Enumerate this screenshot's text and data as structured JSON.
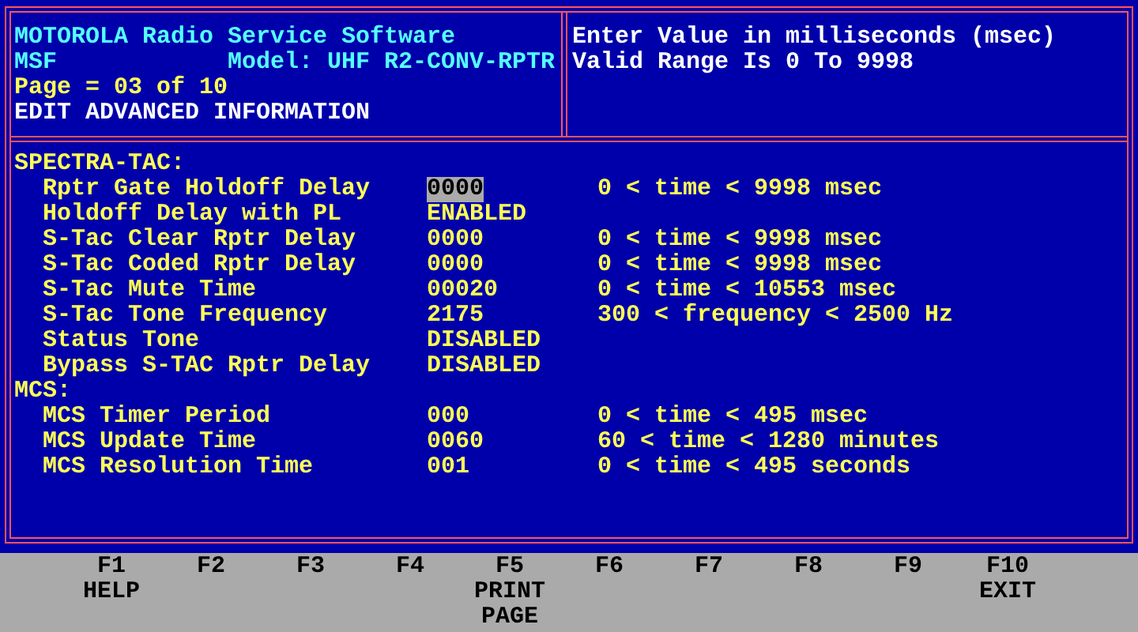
{
  "header": {
    "title": "MOTOROLA Radio Service Software",
    "app_code": "MSF",
    "model": "Model: UHF R2-CONV-RPTR",
    "page": "Page = 03 of 10",
    "mode": "EDIT ADVANCED INFORMATION"
  },
  "help": [
    "Enter Value in milliseconds (msec)",
    "Valid Range Is 0 To 9998"
  ],
  "sections": [
    {
      "heading": "SPECTRA-TAC:",
      "fields": [
        {
          "label": "Rptr Gate Holdoff Delay",
          "value": "0000",
          "range": "0 < time < 9998 msec",
          "selected": true
        },
        {
          "label": "Holdoff Delay with PL",
          "value": "ENABLED",
          "selected": false
        },
        {
          "label": "S-Tac Clear Rptr Delay",
          "value": "0000",
          "range": "0 < time < 9998 msec",
          "selected": false
        },
        {
          "label": "S-Tac Coded Rptr Delay",
          "value": "0000",
          "range": "0 < time < 9998 msec",
          "selected": false
        },
        {
          "label": "S-Tac Mute Time",
          "value": "00020",
          "range": "0 < time < 10553 msec",
          "selected": false
        },
        {
          "label": "S-Tac Tone Frequency",
          "value": "2175",
          "range": "300 < frequency < 2500 Hz",
          "selected": false
        },
        {
          "label": "Status Tone",
          "value": "DISABLED",
          "selected": false
        },
        {
          "label": "Bypass S-TAC Rptr Delay",
          "value": "DISABLED",
          "selected": false
        }
      ]
    },
    {
      "heading": "MCS:",
      "fields": [
        {
          "label": "MCS Timer Period",
          "value": "000",
          "range": "0 < time < 495 msec",
          "selected": false
        },
        {
          "label": "MCS Update Time",
          "value": "0060",
          "range": "60 < time < 1280 minutes",
          "selected": false
        },
        {
          "label": "MCS Resolution Time",
          "value": "001",
          "range": "0 < time < 495 seconds",
          "selected": false
        }
      ]
    }
  ],
  "function_keys": [
    {
      "key": "F1",
      "label": [
        "HELP"
      ]
    },
    {
      "key": "F2"
    },
    {
      "key": "F3"
    },
    {
      "key": "F4"
    },
    {
      "key": "F5",
      "label": [
        "PRINT",
        "PAGE"
      ]
    },
    {
      "key": "F6"
    },
    {
      "key": "F7"
    },
    {
      "key": "F8"
    },
    {
      "key": "F9"
    },
    {
      "key": "F10",
      "label": [
        "EXIT"
      ]
    }
  ]
}
